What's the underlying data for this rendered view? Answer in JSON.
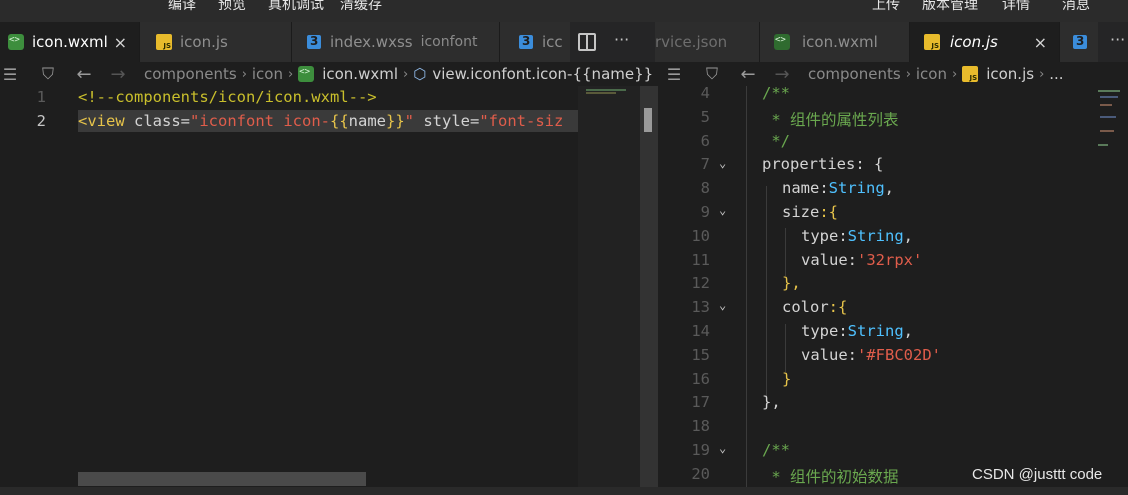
{
  "toolbar": {
    "items_left": [
      "编译",
      "预览",
      "真机调试",
      "清缓存"
    ],
    "items_right": [
      "上传",
      "版本管理",
      "详情",
      "消息"
    ]
  },
  "tabs_left": [
    {
      "label": "icon.wxml",
      "icon": "wxml-file-icon",
      "active": true,
      "close": "×"
    },
    {
      "label": "icon.js",
      "icon": "js-file-icon"
    },
    {
      "label": "index.wxss",
      "desc": "iconfont",
      "icon": "css-file-icon"
    },
    {
      "label": "icc",
      "icon": "css-file-icon"
    }
  ],
  "tabs_right": [
    {
      "label": "rvice.json"
    },
    {
      "label": "icon.wxml",
      "icon": "wxml-file-icon"
    },
    {
      "label": "icon.js",
      "icon": "js-file-icon",
      "active": true,
      "close": "×"
    },
    {
      "label": "",
      "icon": "css-file-icon"
    }
  ],
  "split_icon": "split-editor-icon",
  "more_glyph": "···",
  "breadcrumb_left": {
    "parts": [
      "components",
      "icon",
      "icon.wxml",
      "view.iconfont.icon-{{name}}"
    ]
  },
  "breadcrumb_right": {
    "parts": [
      "components",
      "icon",
      "icon.js",
      "..."
    ]
  },
  "left_editor": {
    "line_numbers": [
      "1",
      "2"
    ],
    "line1": "<!--components/icon/icon.wxml-->",
    "line2": {
      "tag_open": "<view",
      "attr1": " class=",
      "str1a": "\"iconfont icon-",
      "brace_open": "{{",
      "var": "name",
      "brace_close": "}}",
      "str1b": "\"",
      "attr2": " style=",
      "str2": "\"font-siz"
    }
  },
  "right_editor": {
    "line_numbers": [
      "4",
      "5",
      "6",
      "7",
      "8",
      "9",
      "10",
      "11",
      "12",
      "13",
      "14",
      "15",
      "16",
      "17",
      "18",
      "19",
      "20"
    ],
    "lines": {
      "l4": "/**",
      "l5": " * 组件的属性列表",
      "l6": " */",
      "l7_key": "properties",
      "l7_rest": ": {",
      "l8_key": "name",
      "l8_type": "String",
      "l8_rest": ",",
      "l9_key": "size",
      "l9_rest": ":{",
      "l10_key": "type",
      "l10_type": "String",
      "l10_rest": ",",
      "l11_key": "value",
      "l11_str": "'32rpx'",
      "l12": "},",
      "l13_key": "color",
      "l13_rest": ":{",
      "l14_key": "type",
      "l14_type": "String",
      "l14_rest": ",",
      "l15_key": "value",
      "l15_str": "'#FBC02D'",
      "l16": "}",
      "l17": "},",
      "l19": "/**",
      "l20": " * 组件的初始数据"
    }
  },
  "watermark": "CSDN @justtt code",
  "colors": {
    "background": "#1e1e1e",
    "accent_string": "#e05d4b",
    "accent_type": "#4fc1ff"
  }
}
